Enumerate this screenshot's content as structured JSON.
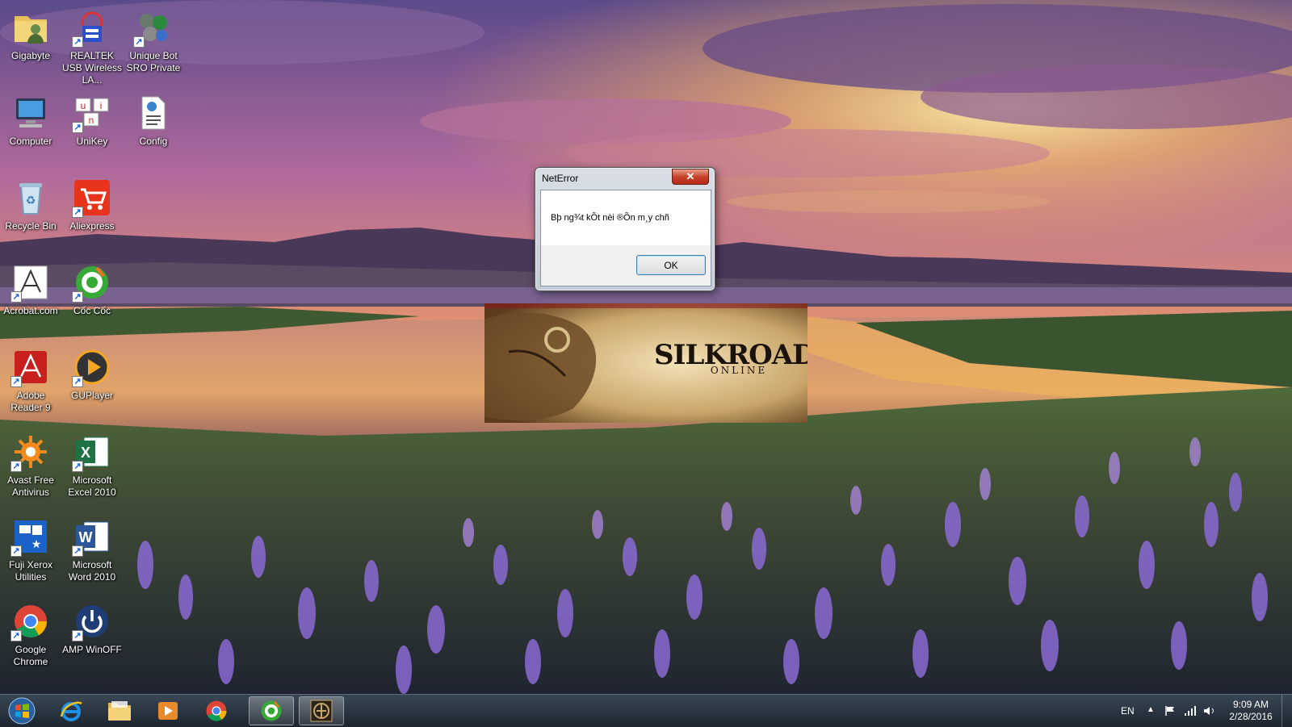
{
  "desktop": {
    "icons": [
      {
        "id": "gigabyte",
        "label": "Gigabyte",
        "icon": "user-folder-icon",
        "shortcut": false
      },
      {
        "id": "realtek",
        "label": "REALTEK USB Wireless LA...",
        "icon": "network-utility-icon",
        "shortcut": true
      },
      {
        "id": "uniquebot",
        "label": "Unique Bot SRO Private",
        "icon": "bot-gears-icon",
        "shortcut": true
      },
      {
        "id": "computer",
        "label": "Computer",
        "icon": "computer-icon",
        "shortcut": false
      },
      {
        "id": "unikey",
        "label": "UniKey",
        "icon": "unikey-icon",
        "shortcut": true
      },
      {
        "id": "config",
        "label": "Config",
        "icon": "config-file-icon",
        "shortcut": false
      },
      {
        "id": "recycle",
        "label": "Recycle Bin",
        "icon": "recycle-bin-icon",
        "shortcut": false
      },
      {
        "id": "aliexpress",
        "label": "Aliexpress",
        "icon": "shopping-cart-icon",
        "shortcut": true
      },
      {
        "id": "acrobat",
        "label": "Acrobat.com",
        "icon": "acrobat-icon",
        "shortcut": true
      },
      {
        "id": "coccoc",
        "label": "Cốc Cốc",
        "icon": "coccoc-browser-icon",
        "shortcut": true
      },
      {
        "id": "adobereader",
        "label": "Adobe Reader 9",
        "icon": "adobe-reader-icon",
        "shortcut": true
      },
      {
        "id": "guplayer",
        "label": "GUPlayer",
        "icon": "media-player-icon",
        "shortcut": true
      },
      {
        "id": "avast",
        "label": "Avast Free Antivirus",
        "icon": "avast-icon",
        "shortcut": true
      },
      {
        "id": "excel",
        "label": "Microsoft Excel 2010",
        "icon": "excel-icon",
        "shortcut": true
      },
      {
        "id": "fujixerox",
        "label": "Fuji Xerox Utilities",
        "icon": "printer-utilities-icon",
        "shortcut": true
      },
      {
        "id": "word",
        "label": "Microsoft Word 2010",
        "icon": "word-icon",
        "shortcut": true
      },
      {
        "id": "chrome",
        "label": "Google Chrome",
        "icon": "chrome-icon",
        "shortcut": true
      },
      {
        "id": "ampwinoff",
        "label": "AMP WinOFF",
        "icon": "power-icon",
        "shortcut": true
      }
    ]
  },
  "dialog": {
    "title": "NetError",
    "message": "Bþ ng¾t kÕt nèi ®Õn m¸y chñ",
    "ok_label": "OK",
    "close_glyph": "✕"
  },
  "splash": {
    "logo_main": "SILKROAD",
    "logo_sub": "ONLINE"
  },
  "taskbar": {
    "pinned": [
      {
        "id": "ie",
        "icon": "internet-explorer-icon",
        "active": false
      },
      {
        "id": "explorer",
        "icon": "folder-icon",
        "active": false
      },
      {
        "id": "mediaplayer",
        "icon": "media-player-icon",
        "active": false
      },
      {
        "id": "chrome",
        "icon": "chrome-icon",
        "active": false
      },
      {
        "id": "coccoc",
        "icon": "coccoc-browser-icon",
        "active": true
      },
      {
        "id": "silkroad",
        "icon": "silkroad-game-icon",
        "active": true
      }
    ],
    "tray": {
      "language": "EN",
      "time": "9:09 AM",
      "date": "2/28/2016"
    }
  },
  "colors": {
    "accent": "#1d5fd6",
    "close_red": "#c7412a",
    "taskbar": "#1c2a38"
  }
}
